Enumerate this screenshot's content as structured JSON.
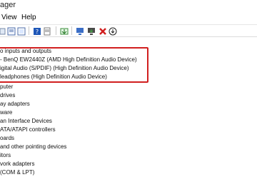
{
  "window": {
    "title": "ager"
  },
  "menu": {
    "view": "View",
    "help": "Help"
  },
  "toolbar": {
    "icons": [
      "properties-icon",
      "help-icon",
      "hidden-devices-icon",
      "update-driver-icon",
      "uninstall-icon",
      "scan-hardware-icon"
    ]
  },
  "tree": {
    "category": "o inputs and outputs",
    "children": [
      "- BenQ EW2440Z (AMD High Definition Audio Device)",
      "igital Audio (S/PDIF) (High Definition Audio Device)",
      "leadphones (High Definition Audio Device)"
    ],
    "rows": [
      "puter",
      "drives",
      "ay adapters",
      "ware",
      "an Interface Devices",
      "ATA/ATAPI controllers",
      "oards",
      "and other pointing devices",
      "itors",
      "vork adapters",
      "(COM & LPT)"
    ]
  },
  "colors": {
    "highlight": "#d11f1f"
  }
}
